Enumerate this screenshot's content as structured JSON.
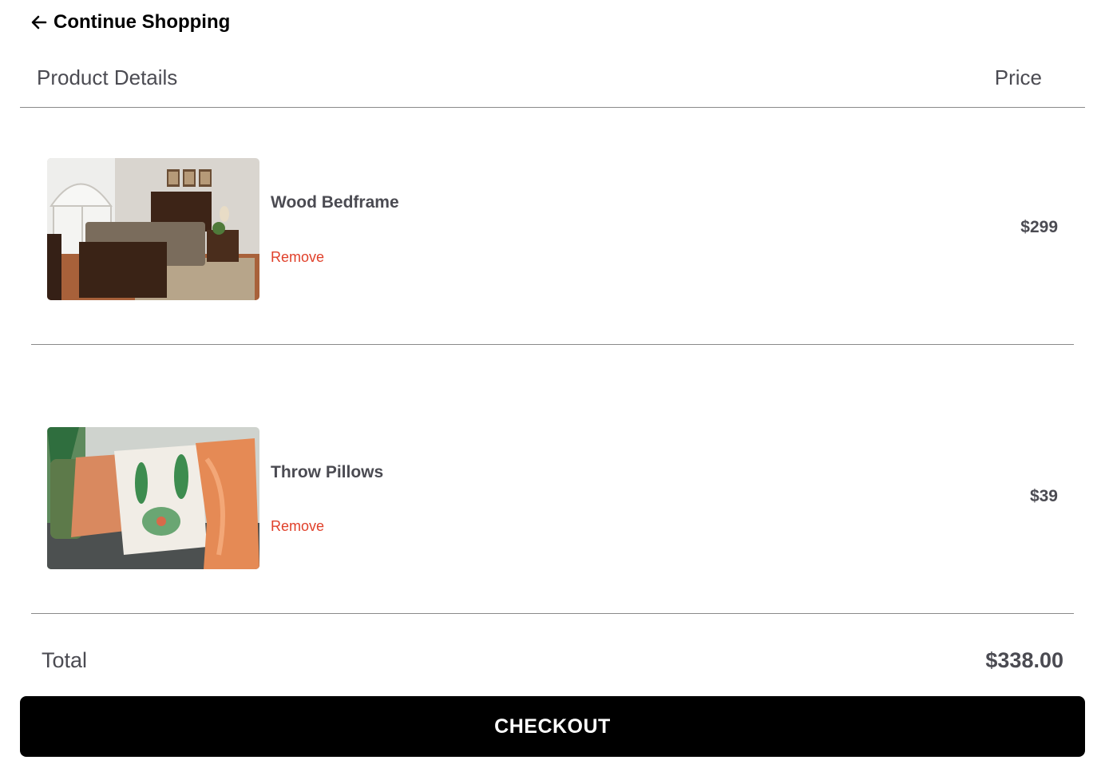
{
  "nav": {
    "back_label": "Continue Shopping",
    "back_icon": "arrow-left-icon"
  },
  "cart_header": {
    "product_col": "Product Details",
    "price_col": "Price"
  },
  "items": [
    {
      "name": "Wood Bedframe",
      "remove_label": "Remove",
      "price": "$299"
    },
    {
      "name": "Throw Pillows",
      "remove_label": "Remove",
      "price": "$39"
    }
  ],
  "summary": {
    "total_label": "Total",
    "total_value": "$338.00"
  },
  "checkout": {
    "label": "CHECKOUT"
  },
  "colors": {
    "text_primary": "#4b4b52",
    "remove": "#e0402a",
    "button_bg": "#000000",
    "divider": "#8a8a8a"
  }
}
